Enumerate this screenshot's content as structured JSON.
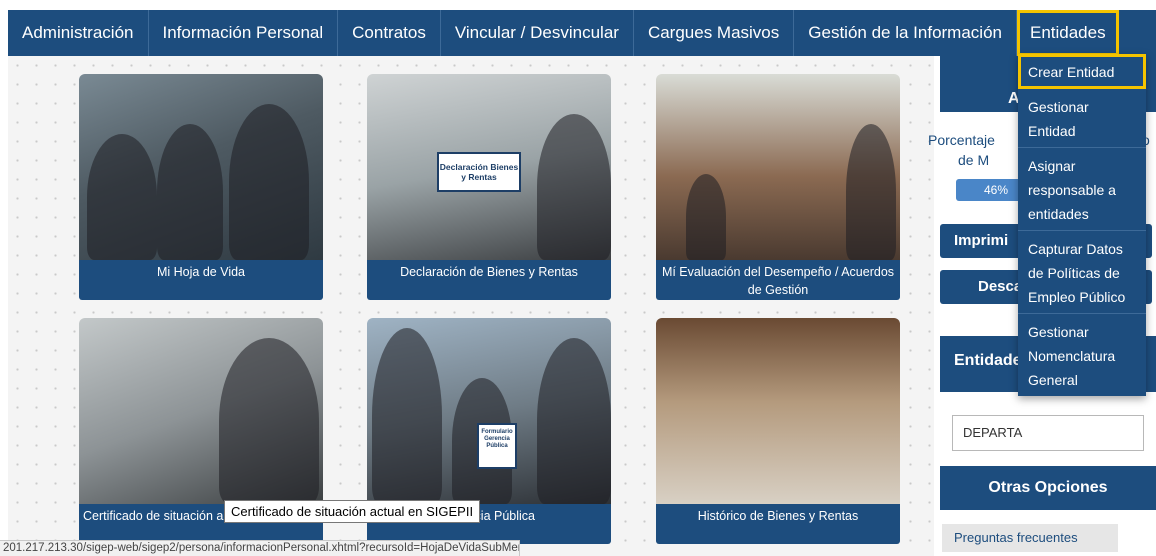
{
  "nav": {
    "items": [
      "Administración",
      "Información Personal",
      "Contratos",
      "Vincular / Desvincular",
      "Cargues Masivos",
      "Gestión de la Información",
      "Entidades"
    ]
  },
  "cards": [
    {
      "caption": "Mi Hoja de Vida"
    },
    {
      "caption": "Declaración de Bienes y Rentas",
      "sign_text": "Declaración Bienes y Rentas"
    },
    {
      "caption": "Mí Evaluación del Desempeño / Acuerdos de Gestión"
    },
    {
      "caption": "Certificado de situación a"
    },
    {
      "caption": "de Gerencia Pública",
      "sign_text": "Formulario Gerencia Pública"
    },
    {
      "caption": "Histórico de Bienes y Rentas"
    }
  ],
  "sidebar": {
    "panel1_title_partial": "Ar",
    "percent_label_line1": "Porcentaje",
    "percent_label_line1_right": "o",
    "percent_label_line2": "de M",
    "progress_value": "46%",
    "progress_fraction": 0.46,
    "print_button": "Imprimi",
    "download_button": "Descar",
    "entities_title_partial": "Entidade",
    "select_value": "DEPARTA",
    "other_options_title": "Otras Opciones",
    "faq_link": "Preguntas frecuentes"
  },
  "dropdown": {
    "items": [
      "Crear Entidad",
      "Gestionar Entidad",
      "Asignar responsable a entidades",
      "Capturar Datos de Políticas de Empleo Público",
      "Gestionar Nomenclatura General"
    ]
  },
  "tooltip": "Certificado de situación actual en SIGEPII",
  "status_url": "201.217.213.30/sigep-web/sigep2/persona/informacionPersonal.xhtml?recursoId=HojaDeVidaSubMenu#",
  "colors": {
    "brand": "#1d4d7e",
    "highlight": "#f5c400"
  }
}
